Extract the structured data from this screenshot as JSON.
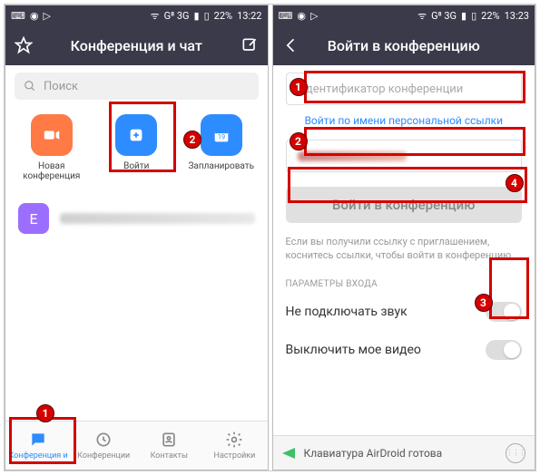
{
  "left": {
    "statusbar": {
      "time": "13:22",
      "battery": "22%",
      "net": "G⁸ 3G"
    },
    "appbar": {
      "title": "Конференция и чат"
    },
    "search": {
      "placeholder": "Поиск"
    },
    "actions": {
      "new": "Новая конференция",
      "join": "Войти",
      "schedule": "Запланировать",
      "schedule_day": "19"
    },
    "contact": {
      "initial": "Е"
    },
    "tabs": {
      "chat": "Конференция и",
      "meetings": "Конференции",
      "contacts": "Контакты",
      "settings": "Настройки"
    }
  },
  "right": {
    "statusbar": {
      "time": "13:23",
      "battery": "22%",
      "net": "G⁸ 3G"
    },
    "appbar": {
      "title": "Войти в конференцию"
    },
    "id_placeholder": "Идентификатор конференции",
    "link_hint": "Войти по имени персональной ссылки",
    "join_button": "Войти в конференцию",
    "help_text": "Если вы получили ссылку с приглашением, коснитесь ссылки, чтобы войти в конференцию",
    "section": "ПАРАМЕТРЫ ВХОДА",
    "toggle_audio": "Не подключать звук",
    "toggle_video": "Выключить мое видео",
    "keyboard": "Клавиатура AirDroid готова"
  }
}
